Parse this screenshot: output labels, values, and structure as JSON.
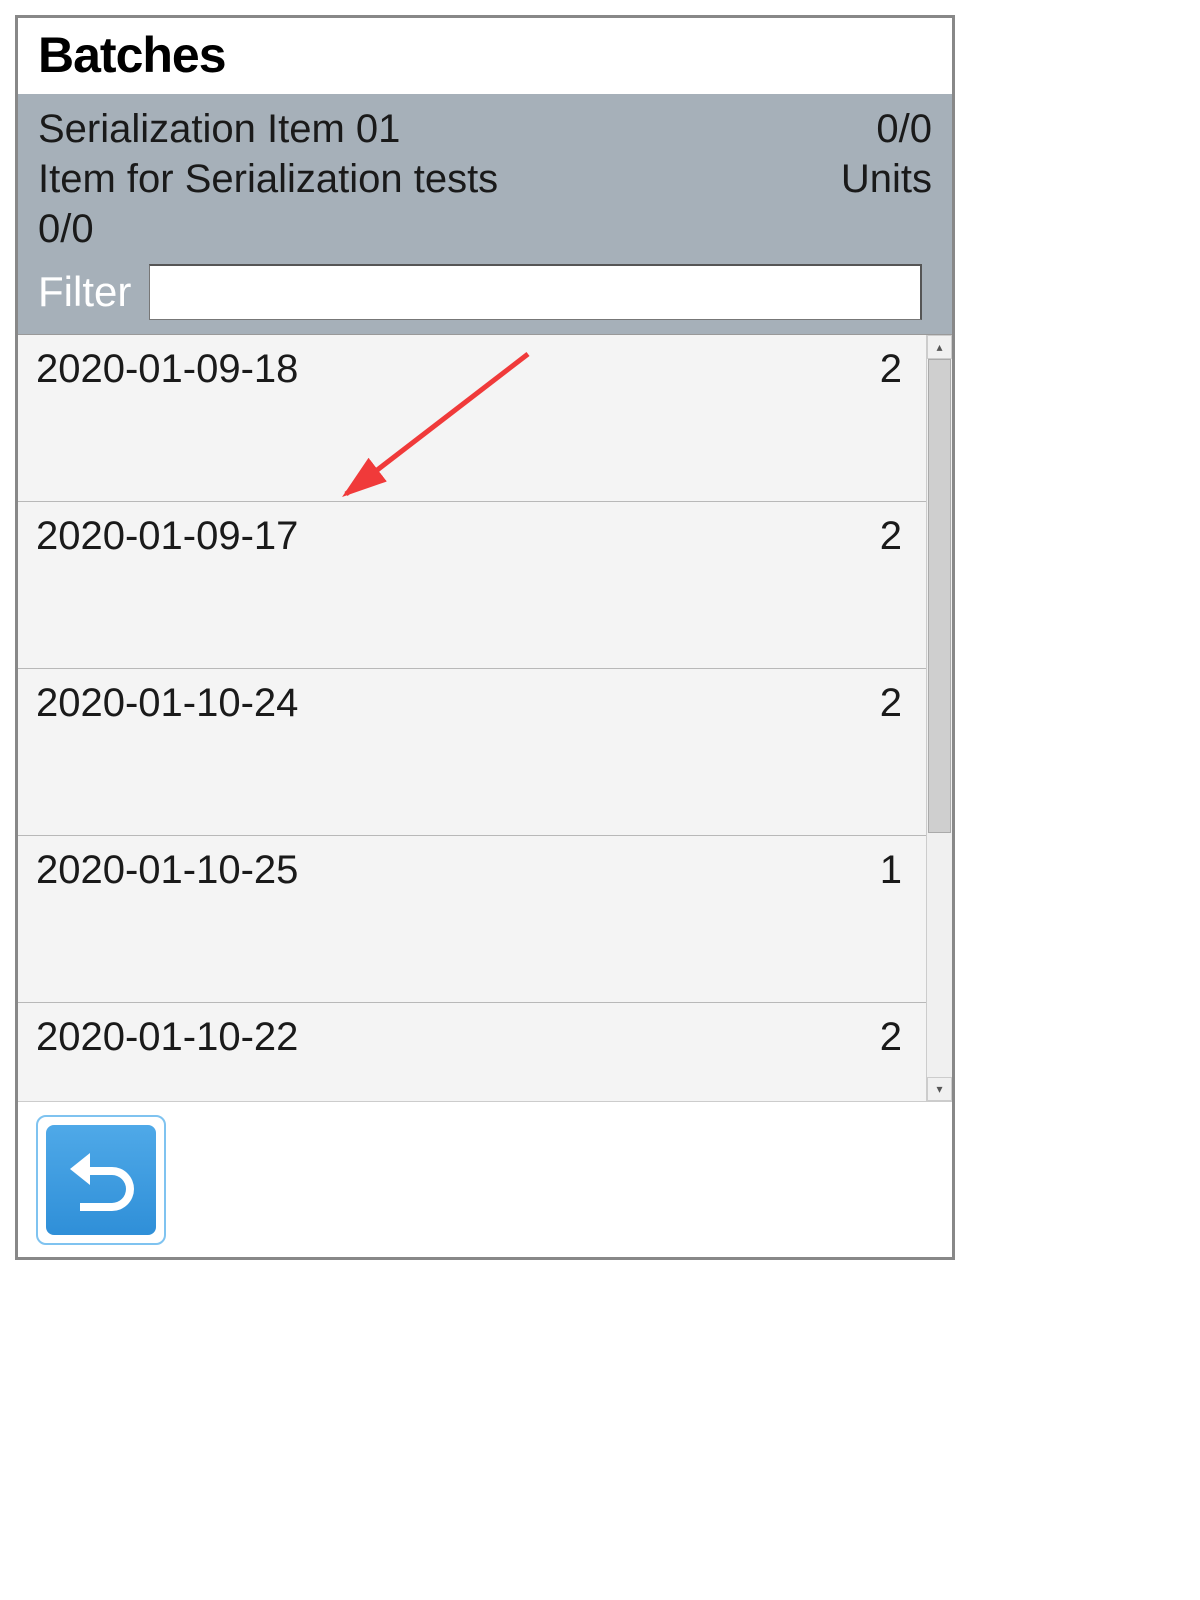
{
  "header": {
    "title": "Batches"
  },
  "info": {
    "item_name": "Serialization Item 01",
    "count_top": "0/0",
    "description": "Item for Serialization tests",
    "units_label": "Units",
    "count_bottom": "0/0"
  },
  "filter": {
    "label": "Filter",
    "value": ""
  },
  "batches": [
    {
      "id": "2020-01-09-18",
      "qty": "2"
    },
    {
      "id": "2020-01-09-17",
      "qty": "2"
    },
    {
      "id": "2020-01-10-24",
      "qty": "2"
    },
    {
      "id": "2020-01-10-25",
      "qty": "1"
    },
    {
      "id": "2020-01-10-22",
      "qty": "2"
    }
  ],
  "icons": {
    "back": "back-icon"
  },
  "annotation": {
    "arrow_color": "#f03a3a"
  }
}
